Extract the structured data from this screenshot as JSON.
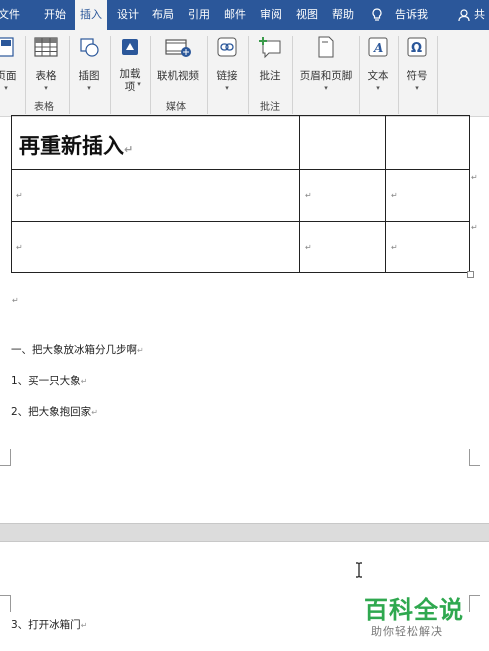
{
  "tabs": [
    "文件",
    "开始",
    "插入",
    "设计",
    "布局",
    "引用",
    "邮件",
    "审阅",
    "视图",
    "帮助",
    "告诉我",
    "共"
  ],
  "active_tab": "插入",
  "ribbon": {
    "page_btn": "页面",
    "table_btn": "表格",
    "illustrations_btn": "插图",
    "addins_btn_1": "加载",
    "addins_btn_2": "项",
    "video_btn": "联机视频",
    "link_btn": "链接",
    "comment_btn": "批注",
    "header_footer_btn": "页眉和页脚",
    "text_btn": "文本",
    "symbol_btn": "符号",
    "group_table": "表格",
    "group_media": "媒体",
    "group_comments": "批注"
  },
  "document": {
    "table_heading": "再重新插入",
    "heading1": "一、把大象放冰箱分几步啊",
    "item1": "1、买一只大象",
    "item2": "2、把大象抱回家",
    "item3": "3、打开冰箱门",
    "para_mark": "↵"
  },
  "watermark": {
    "brand": "百科全说",
    "sub": "助你轻松解决"
  }
}
